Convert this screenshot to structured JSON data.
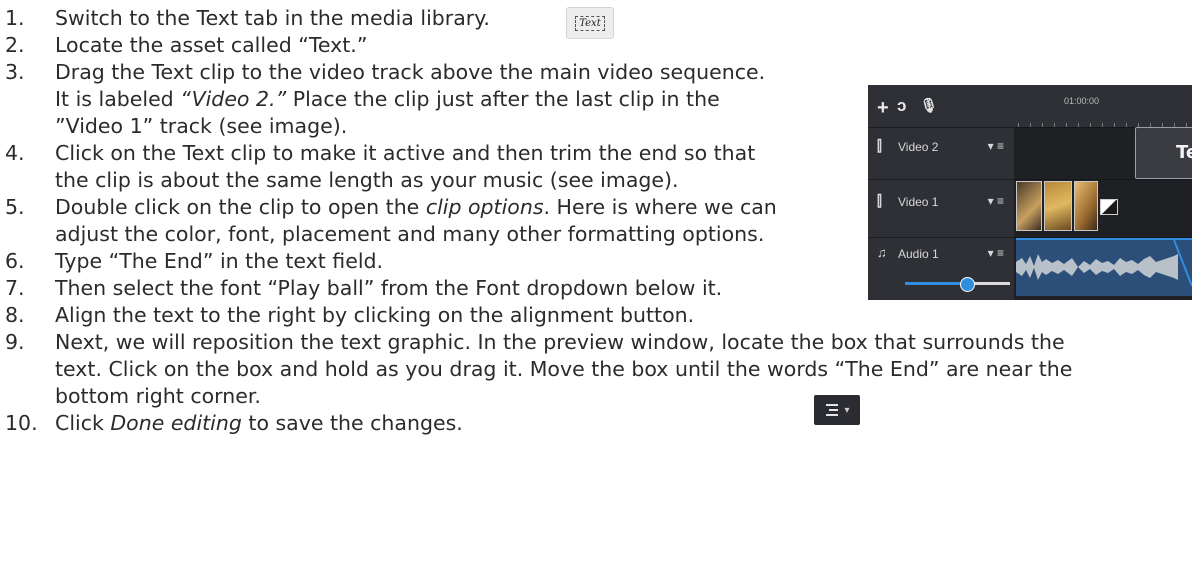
{
  "steps": [
    {
      "num": "1.",
      "lines": [
        "Switch to the Text tab in the media library."
      ]
    },
    {
      "num": "2.",
      "lines": [
        "Locate the asset called “Text.”"
      ]
    },
    {
      "num": "3.",
      "parts": [
        [
          "Drag the Text clip to the video track above the main video sequence."
        ],
        [
          "It is labeled ",
          "“Video 2.”",
          " Place the clip just after the last clip in the"
        ],
        [
          "”Video 1” track (see image)."
        ]
      ]
    },
    {
      "num": "4.",
      "lines": [
        "Click on the Text clip to make it active and then trim the end so that",
        "the clip is about the same length as your music (see image)."
      ]
    },
    {
      "num": "5.",
      "parts": [
        [
          "Double click on the clip to open the ",
          "clip options",
          ". Here is where we can"
        ],
        [
          "adjust the color, font, placement and many other formatting options."
        ]
      ]
    },
    {
      "num": "6.",
      "lines": [
        "Type “The End” in the text field."
      ]
    },
    {
      "num": "7.",
      "lines": [
        "Then select the font “Play ball” from the Font dropdown below it."
      ]
    },
    {
      "num": "8.",
      "lines": [
        "Align the text to the right by clicking on the alignment button."
      ]
    },
    {
      "num": "9.",
      "lines": [
        "Next, we will reposition the text graphic. In the preview window, locate the box that surrounds the",
        "text. Click on the box and hold as you drag it.  Move the box until the words “The End” are near the",
        "bottom right corner."
      ]
    },
    {
      "num": "10.",
      "parts": [
        [
          "Click ",
          "Done editing",
          " to save the changes."
        ]
      ]
    }
  ],
  "icons": {
    "text_tab": {
      "name": "text-tab-icon",
      "label": "Text"
    },
    "alignment": {
      "name": "align-right-icon",
      "caret": "▾"
    }
  },
  "editor": {
    "timecode": "01:00:00",
    "toolbar_icons": [
      "add-icon",
      "magnet-icon",
      "microphone-icon"
    ],
    "tracks": [
      {
        "label": "Video 2",
        "icon": "film-icon",
        "controls": "▾ ≡"
      },
      {
        "label": "Video 1",
        "icon": "film-icon",
        "controls": "▾ ≡"
      },
      {
        "label": "Audio 1",
        "icon": "music-note-icon",
        "controls": "▾ ≡"
      }
    ],
    "text_clip_label": "Tex",
    "audio_volume": 0.6,
    "colors": {
      "panel": "#26282d",
      "accent": "#2f8ee0",
      "audio_clip": "#2b4f78"
    }
  }
}
